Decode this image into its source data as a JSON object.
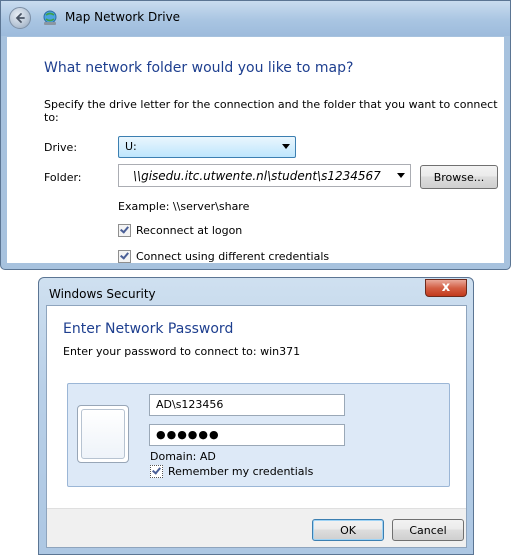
{
  "map_network_drive": {
    "title": "Map Network Drive",
    "heading": "What network folder would you like to map?",
    "instructions": "Specify the drive letter for the connection and the folder that you want to connect to:",
    "drive_label": "Drive:",
    "drive_value": "U:",
    "folder_label": "Folder:",
    "folder_value": "\\\\gisedu.itc.utwente.nl\\student\\s1234567",
    "browse_label": "Browse...",
    "example_text": "Example: \\\\server\\share",
    "reconnect_label": "Reconnect at logon",
    "reconnect_checked": true,
    "credentials_label": "Connect using different credentials",
    "credentials_checked": true
  },
  "windows_security": {
    "title": "Windows Security",
    "close_glyph": "x",
    "heading": "Enter Network Password",
    "subtitle": "Enter your password to connect to: win371",
    "username_value": "AD\\s123456",
    "password_value": "●●●●●●",
    "domain_text": "Domain: AD",
    "remember_label": "Remember my credentials",
    "remember_checked": true,
    "ok_label": "OK",
    "cancel_label": "Cancel"
  },
  "colors": {
    "heading_blue": "#1e3f8f",
    "titlebar_blue": "#a9c5e2",
    "close_red": "#c23a1d"
  }
}
